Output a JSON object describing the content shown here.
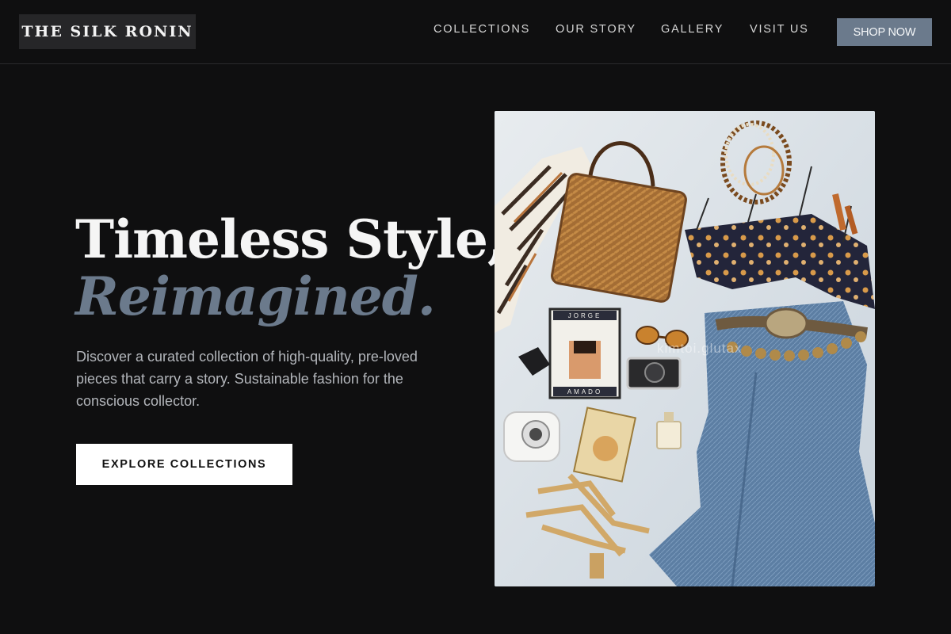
{
  "brand": {
    "name": "THE SILK RONIN"
  },
  "nav": {
    "items": [
      {
        "label": "COLLECTIONS"
      },
      {
        "label": "OUR STORY"
      },
      {
        "label": "GALLERY"
      },
      {
        "label": "VISIT US"
      }
    ],
    "cta_label": "SHOP NOW"
  },
  "hero": {
    "title_line1": "Timeless Style,",
    "title_line2": "Reimagined.",
    "description": "Discover a curated collection of high-quality, pre-loved pieces that carry a story. Sustainable fashion for the conscious collector.",
    "button_label": "EXPLORE COLLECTIONS"
  },
  "image": {
    "book_top_text": "JORGE",
    "book_bottom_text": "AMADO",
    "watermark": "kimtoi.glutax"
  },
  "colors": {
    "background": "#0f0f10",
    "accent": "#6b7a8c",
    "text": "#f5f5f5",
    "muted_text": "#b3b6bb"
  }
}
